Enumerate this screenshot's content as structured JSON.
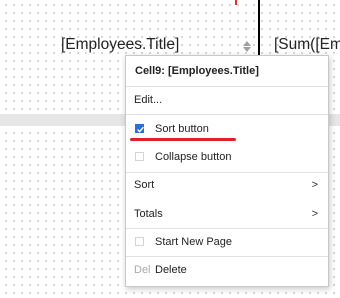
{
  "canvas": {
    "left_cell": "[Employees.Title]",
    "right_cell": "[Sum([Em"
  },
  "context_menu": {
    "header": "Cell9: [Employees.Title]",
    "items": [
      {
        "label": "Edit..."
      },
      {
        "label": "Sort button",
        "checked": true
      },
      {
        "label": "Collapse button",
        "checked": false
      },
      {
        "label": "Sort",
        "arrow": ">"
      },
      {
        "label": "Totals",
        "arrow": ">"
      },
      {
        "label": "Start New Page",
        "checked": false
      },
      {
        "label": "Delete",
        "shortcut": "Del"
      }
    ]
  },
  "colors": {
    "checkbox_accent": "#2a70d8",
    "annotation_red": "#e3202a"
  }
}
